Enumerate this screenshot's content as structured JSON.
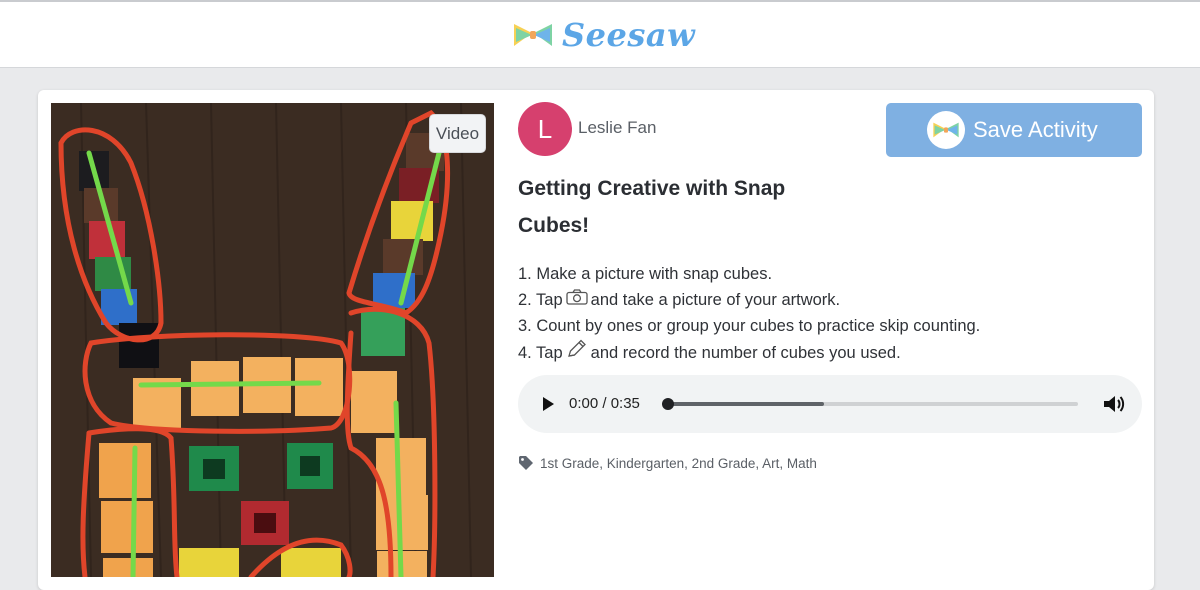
{
  "brand": {
    "name": "Seesaw",
    "logo_icon": "seesaw-bowtie-icon"
  },
  "media": {
    "badge_label": "Video"
  },
  "author": {
    "initial": "L",
    "name": "Leslie Fan",
    "avatar_color": "#d6406e"
  },
  "save_button": {
    "label": "Save Activity",
    "color": "#7fb0e2"
  },
  "activity": {
    "title": "Getting Creative with Snap Cubes!",
    "steps": [
      {
        "before": "1. Make a picture with snap cubes.",
        "icon": "",
        "after": ""
      },
      {
        "before": "2. Tap",
        "icon": "camera-icon",
        "after": "and take a picture of your artwork."
      },
      {
        "before": "3. Count by ones or group your cubes to practice skip counting.",
        "icon": "",
        "after": ""
      },
      {
        "before": "4. Tap",
        "icon": "pencil-icon",
        "after": "and record the number of cubes you used."
      }
    ]
  },
  "audio_player": {
    "time": "0:00 / 0:35",
    "progress": 0.38
  },
  "tags": {
    "icon": "tag-icon",
    "text": "1st Grade, Kindergarten, 2nd Grade, Art, Math"
  }
}
